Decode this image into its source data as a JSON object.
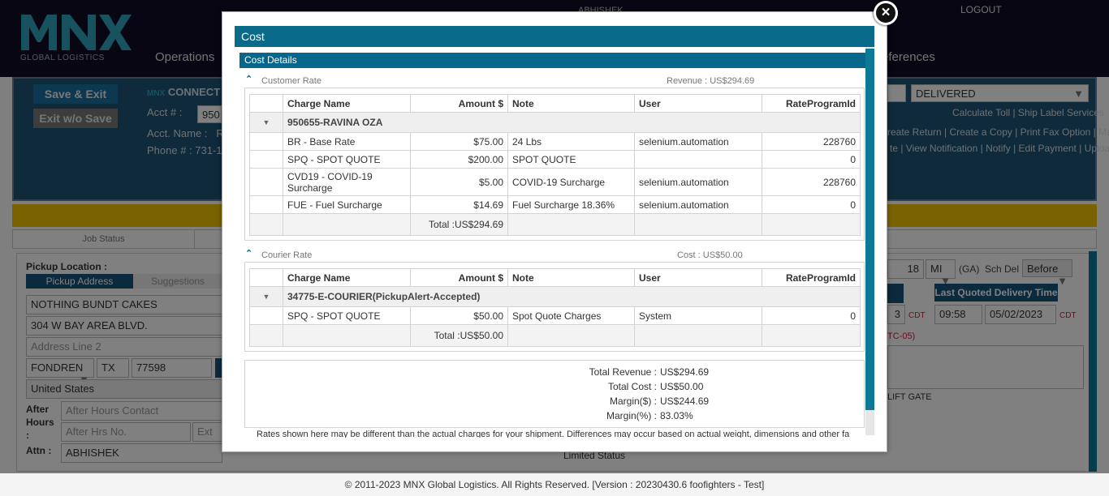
{
  "header": {
    "logo_text": "MNX",
    "logo_sub": "GLOBAL LOGISTICS",
    "user": "ABHISHEK",
    "logout": "LOGOUT",
    "nav_operations": "Operations",
    "nav_preferences": "eferences"
  },
  "background": {
    "save_exit": "Save & Exit",
    "exit_wo_save": "Exit w/o Save",
    "connect_label": "CONNECT",
    "acct_label": "Acct # :",
    "acct_value": "950",
    "acct_name_label": "Acct. Name :",
    "acct_name_value": "R",
    "phone_label": "Phone # : 731-1",
    "status_select": "DELIVERED",
    "links_row1": "Calculate Toll | Ship Label Services",
    "links_row2": "reate Return | Create a Copy | Print Fax Option | Map",
    "links_row3": "te | View Notification | Notify | Edit Payment | Upload",
    "job_status_tab": "Job Status",
    "pickup_location": "Pickup Location :",
    "pickup_address_tab": "Pickup Address",
    "suggestions_tab": "Suggestions",
    "company": "NOTHING BUNDT CAKES",
    "address1": "304 W BAY AREA BLVD.",
    "address2_placeholder": "Address Line 2",
    "city": "FONDREN",
    "state": "TX",
    "zip": "77598",
    "country": "United States",
    "after_hours_label": "After Hours :",
    "after_hours_contact_placeholder": "After Hours Contact",
    "after_hrs_no_placeholder": "After Hrs No.",
    "ext_placeholder": "Ext",
    "attn_label": "Attn :",
    "attn_value": "ABHISHEK",
    "miles_value": "18",
    "mi_unit": "MI",
    "ga_text": "(GA)",
    "sch_del_label": "Sch Del -",
    "sch_del_value": "Before",
    "last_quoted_btn": "Last Quoted Delivery Time",
    "cdt1": "CDT",
    "time_value": "09:58",
    "date_value": "05/02/2023",
    "cdt2": "CDT",
    "tc_text": "TC-05)",
    "lift_gate": "LIFT GATE",
    "limited_text": "Limited Status",
    "three": "3"
  },
  "modal": {
    "title": "Cost",
    "cost_details": "Cost Details",
    "customer_rate": {
      "title": "Customer Rate",
      "revenue_label": "Revenue : US$294.69",
      "columns": [
        "Charge Name",
        "Amount $",
        "Note",
        "User",
        "RateProgramId"
      ],
      "group": "950655-RAVINA OZA",
      "rows": [
        [
          "BR - Base Rate",
          "$75.00",
          "24 Lbs",
          "selenium.automation",
          "228760"
        ],
        [
          "SPQ - SPOT QUOTE",
          "$200.00",
          "SPOT QUOTE",
          "",
          "0"
        ],
        [
          "CVD19 - COVID-19 Surcharge",
          "$5.00",
          "COVID-19 Surcharge",
          "selenium.automation",
          "228760"
        ],
        [
          "FUE - Fuel Surcharge",
          "$14.69",
          "Fuel Surcharge 18.36%",
          "selenium.automation",
          "0"
        ]
      ],
      "total": "Total :US$294.69"
    },
    "courier_rate": {
      "title": "Courier Rate",
      "cost_label": "Cost : US$50.00",
      "columns": [
        "Charge Name",
        "Amount $",
        "Note",
        "User",
        "RateProgramId"
      ],
      "group": "34775-E-COURIER(PickupAlert-Accepted)",
      "rows": [
        [
          "SPQ - SPOT QUOTE",
          "$50.00",
          "Spot Quote Charges",
          "System",
          "0"
        ]
      ],
      "total": "Total :US$50.00"
    },
    "summary": {
      "total_revenue_label": "Total Revenue :",
      "total_revenue": "US$294.69",
      "total_cost_label": "Total Cost :",
      "total_cost": "US$50.00",
      "margin_label": "Margin($) :",
      "margin": "US$244.69",
      "margin_pct_label": "Margin(%) :",
      "margin_pct": "83.03%"
    },
    "disclaimer": "Rates shown here may be different than the actual charges for your shipment. Differences may occur based on actual weight, dimensions and other fa"
  },
  "footer": "© 2011-2023 MNX Global Logistics. All Rights Reserved. [Version : 20230430.6 foofighters - Test]",
  "colors": {
    "modal_header": "#0a6a8a",
    "section_header": "#06668b",
    "topbar": "#100b26"
  }
}
